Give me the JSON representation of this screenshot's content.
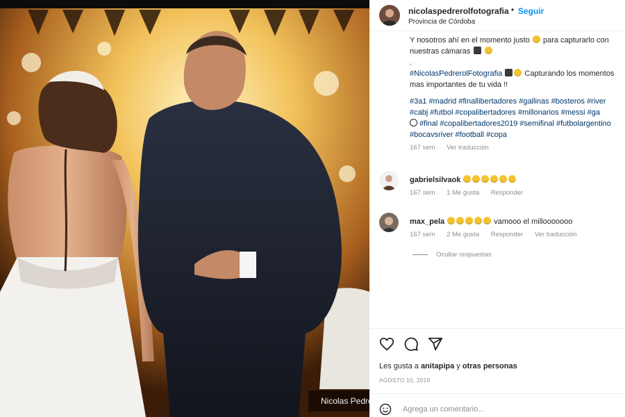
{
  "post": {
    "author": "nicolaspedrerolfotografia",
    "follow_label": "Seguir",
    "location": "Provincia de Córdoba",
    "watermark": "Nicolas Pedrerol"
  },
  "caption": {
    "line1": "Y nosotros ahí en el momento justo",
    "line1b": "para capturarlo con",
    "line2": "nuestras cámaras",
    "line3": ".",
    "line4_tag": "#NicolasPedrerolFotografia",
    "line4_text": "Capturando los momentos",
    "line5": "mas importantes de tu vida !!",
    "tags1": [
      "#3a1",
      "#madrid",
      "#finallibertadores",
      "#gallinas",
      "#bosteros",
      "#river"
    ],
    "tags2": [
      "#cabj",
      "#futbol",
      "#copalibertadores",
      "#millonarios",
      "#messi",
      "#ga"
    ],
    "tags3": [
      "#final",
      "#copalibertadores2019",
      "#semifinal",
      "#futbolargentino"
    ],
    "tags4": [
      "#bocavsriver",
      "#football",
      "#copa"
    ],
    "time": "167 sem",
    "see_translation": "Ver traducción"
  },
  "comments": [
    {
      "user": "gabrielsilvaok",
      "text": "",
      "time": "167 sem",
      "likes": "1 Me gusta",
      "reply": "Responder"
    },
    {
      "user": "max_pela",
      "text": "vamooo el millooooooo",
      "time": "167 sem",
      "likes": "2 Me gusta",
      "reply": "Responder",
      "translation": "Ver traducción"
    }
  ],
  "hide_replies": "Ocultar respuestas",
  "likes": {
    "prefix": "Les gusta a",
    "user": "anitapipa",
    "connector": "y",
    "others": "otras personas"
  },
  "date": "AGOSTO 10, 2019",
  "add_comment": {
    "placeholder": "Agrega un comentario..."
  },
  "icons": [
    "heart-icon",
    "comment-icon",
    "share-icon",
    "emoji-icon"
  ],
  "colors": {
    "link": "#0095f6",
    "hashtag": "#00376b",
    "muted": "#8e8e8e"
  }
}
